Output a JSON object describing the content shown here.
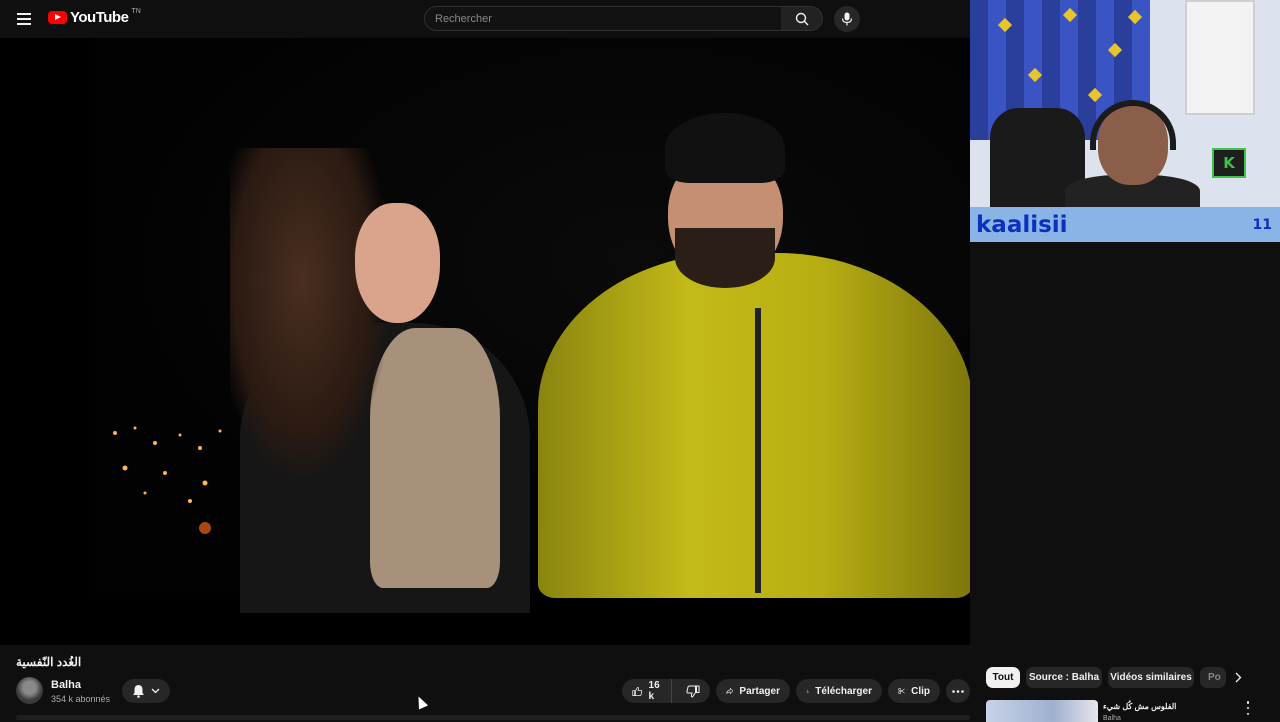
{
  "header": {
    "logo_text": "YouTube",
    "logo_sup": "TN",
    "search_placeholder": "Rechercher"
  },
  "webcam": {
    "name": "kaalisii",
    "count": "11",
    "badge": "K"
  },
  "video": {
    "title": "الغُدد النّفسية",
    "channel": "Balha",
    "subscribers": "354 k abonnés",
    "likes": "16 k",
    "share_label": "Partager",
    "download_label": "Télécharger",
    "clip_label": "Clip"
  },
  "sidebar": {
    "chips": [
      "Tout",
      "Source : Balha",
      "Vidéos similaires",
      "Po"
    ],
    "recommendation": {
      "title": "الفلوس مش كُل شيء",
      "channel": "Balha"
    }
  }
}
